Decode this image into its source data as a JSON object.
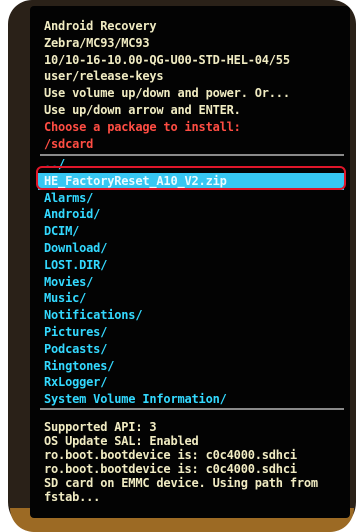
{
  "header": {
    "lines": [
      "Android Recovery",
      "Zebra/MC93/MC93",
      "10/10-16-10.00-QG-U00-STD-HEL-04/55",
      "user/release-keys",
      "Use volume up/down and power. Or...",
      "Use up/down arrow and ENTER."
    ],
    "prompt": "Choose a package to install:",
    "path": "/sdcard"
  },
  "files": {
    "items": [
      "../",
      "HE_FactoryReset_A10_V2.zip",
      "Alarms/",
      "Android/",
      "DCIM/",
      "Download/",
      "LOST.DIR/",
      "Movies/",
      "Music/",
      "Notifications/",
      "Pictures/",
      "Podcasts/",
      "Ringtones/",
      "RxLogger/",
      "System Volume Information/"
    ],
    "selected_index": 1
  },
  "log": {
    "lines": [
      "Supported API: 3",
      "OS Update SAL: Enabled",
      "ro.boot.bootdevice is: c0c4000.sdhci",
      "ro.boot.bootdevice is: c0c4000.sdhci",
      "SD card on EMMC device. Using path from",
      "fstab..."
    ]
  },
  "colors": {
    "header_text": "#f0ebc2",
    "prompt_text": "#ff4d43",
    "file_text": "#33d9ff",
    "selection_bg": "#36c7f2",
    "highlight_ring": "#e0162a"
  }
}
